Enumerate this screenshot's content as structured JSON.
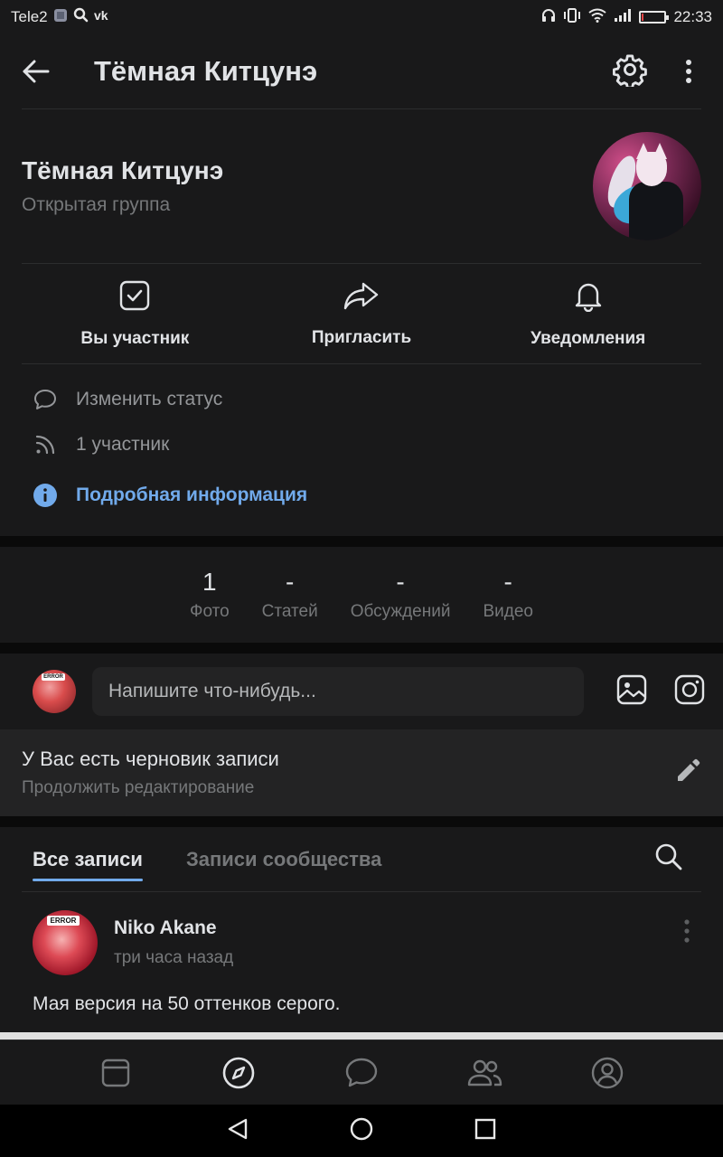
{
  "status_bar": {
    "carrier": "Tele2",
    "time": "22:33",
    "battery_percent": 10
  },
  "top_bar": {
    "title": "Тёмная Китцунэ",
    "icons": [
      "back-arrow-icon",
      "gear-icon",
      "more-vertical-icon"
    ]
  },
  "group": {
    "name": "Тёмная Китцунэ",
    "type": "Открытая группа"
  },
  "actions": [
    {
      "label": "Вы участник",
      "icon": "check-square-icon"
    },
    {
      "label": "Пригласить",
      "icon": "share-arrow-icon"
    },
    {
      "label": "Уведомления",
      "icon": "bell-icon"
    }
  ],
  "meta": {
    "status": "Изменить статус",
    "members": "1 участник",
    "details": "Подробная информация"
  },
  "counters": [
    {
      "value": "1",
      "label": "Фото"
    },
    {
      "value": "-",
      "label": "Статей"
    },
    {
      "value": "-",
      "label": "Обсуждений"
    },
    {
      "value": "-",
      "label": "Видео"
    }
  ],
  "composer": {
    "placeholder": "Напишите что-нибудь..."
  },
  "draft": {
    "title": "У Вас есть черновик записи",
    "subtitle": "Продолжить редактирование"
  },
  "tabs": {
    "all": "Все записи",
    "community": "Записи сообщества"
  },
  "post": {
    "author": "Niko Akane",
    "time": "три часа назад",
    "text": "Мая версия на 50 оттенков серого.",
    "avatar_tag": "ERROR"
  },
  "colors": {
    "background": "#19191a",
    "accent": "#71aaeb",
    "text_primary": "#e1e3e6",
    "text_secondary": "#76787a"
  }
}
